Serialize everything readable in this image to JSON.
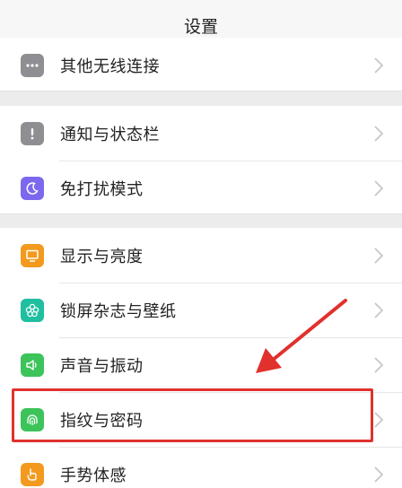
{
  "header": {
    "title": "设置"
  },
  "groups": [
    {
      "items": [
        {
          "label": "其他无线连接",
          "icon": "more-dots-icon",
          "color": "#8e8e93"
        }
      ]
    },
    {
      "items": [
        {
          "label": "通知与状态栏",
          "icon": "notification-exclamation-icon",
          "color": "#8e8e93"
        },
        {
          "label": "免打扰模式",
          "icon": "moon-icon",
          "color": "#7b68ee"
        }
      ]
    },
    {
      "items": [
        {
          "label": "显示与亮度",
          "icon": "monitor-icon",
          "color": "#f39a1e"
        },
        {
          "label": "锁屏杂志与壁纸",
          "icon": "flower-icon",
          "color": "#1fbfa0"
        },
        {
          "label": "声音与振动",
          "icon": "speaker-icon",
          "color": "#3cc45a"
        },
        {
          "label": "指纹与密码",
          "icon": "fingerprint-icon",
          "color": "#3cc45a"
        },
        {
          "label": "手势体感",
          "icon": "hand-gesture-icon",
          "color": "#f39a1e"
        }
      ]
    }
  ],
  "annotation": {
    "highlight_color": "#e0312c",
    "arrow_color": "#e0312c"
  }
}
